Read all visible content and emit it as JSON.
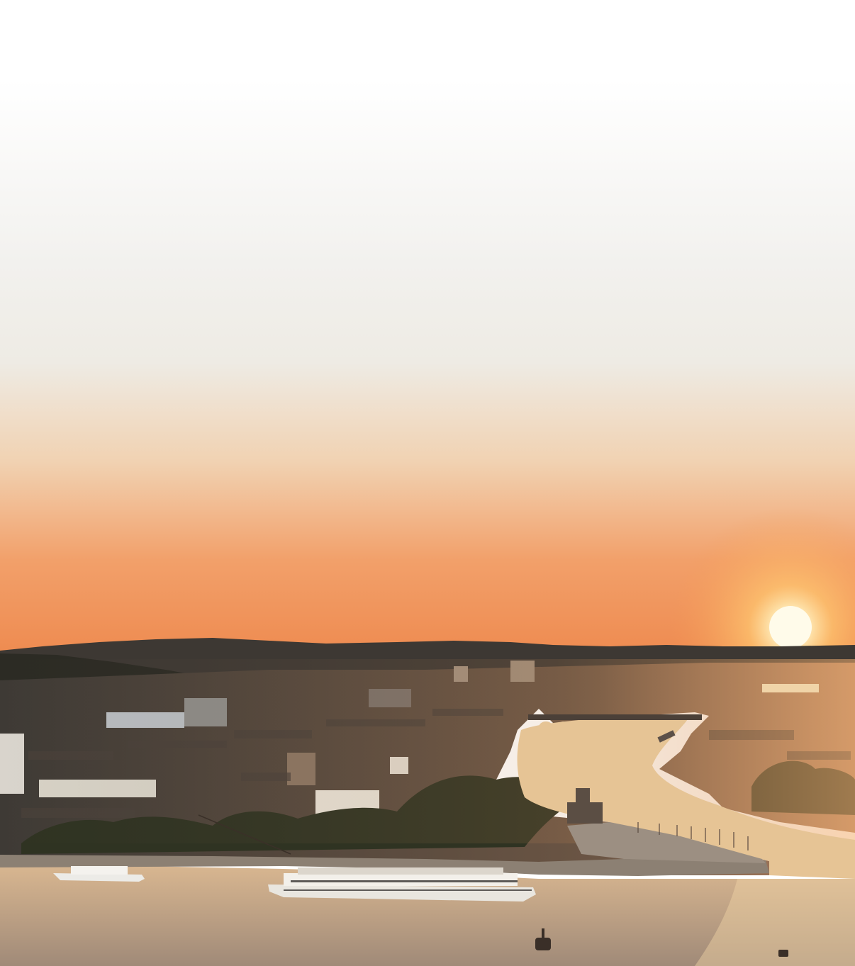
{
  "photo": {
    "subject": "sunset-over-river-confluence-city",
    "colors": {
      "sky_top": "#ffffff",
      "sky_mid": "#efeeea",
      "sky_horizon": "#f0955a",
      "sun": "#fff6d8",
      "sun_glow": "#ffb860",
      "hills": "#3a3631",
      "city": "#5a4a3e",
      "trees": "#2f3322",
      "water": "#c7a889",
      "water_glint": "#f1d4a6"
    }
  }
}
